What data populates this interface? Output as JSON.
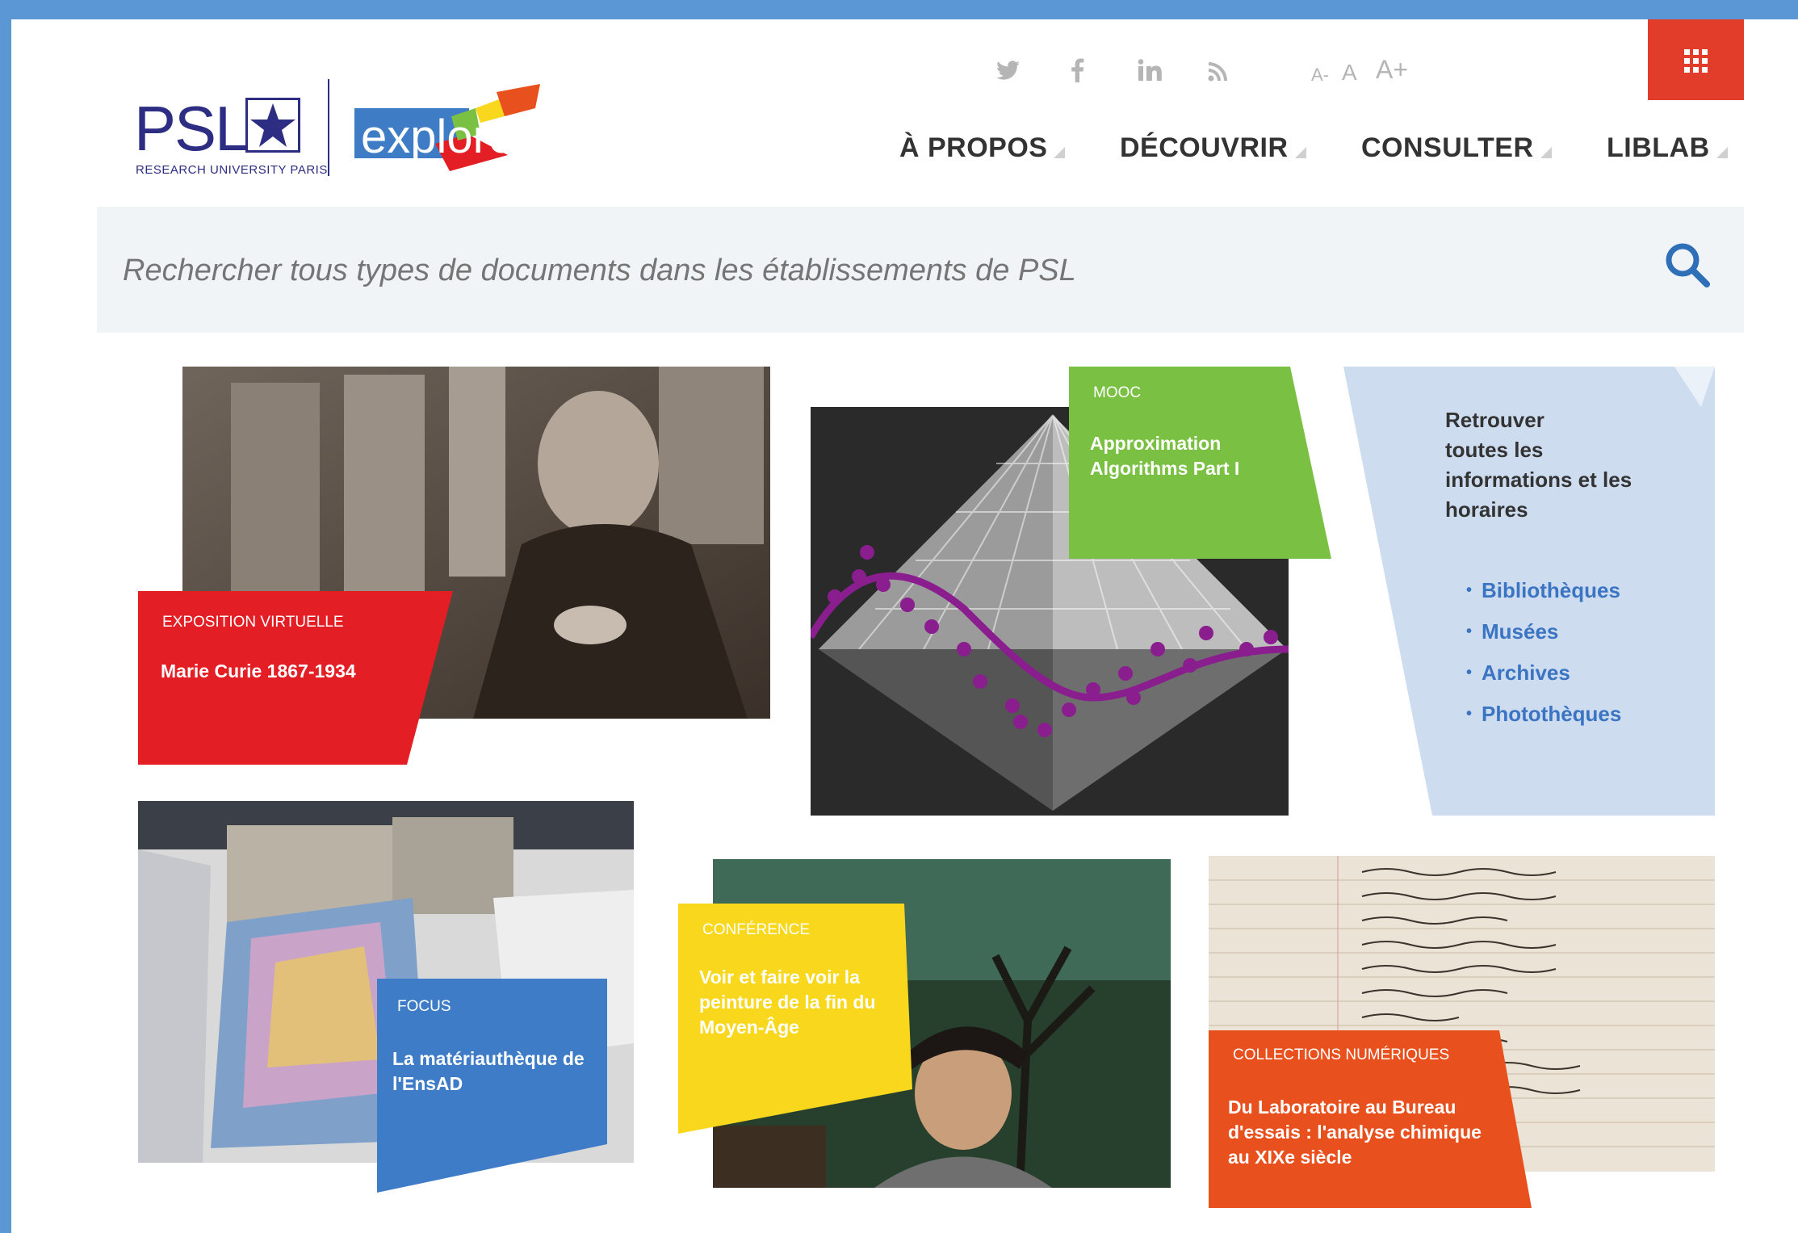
{
  "header": {
    "logo": {
      "psl": "PSL",
      "subtitle": "RESEARCH UNIVERSITY PARIS",
      "explore": "explore"
    },
    "social_icons": [
      "twitter-icon",
      "facebook-icon",
      "linkedin-icon",
      "rss-icon"
    ],
    "font_size": {
      "small": "A-",
      "normal": "A",
      "large": "A+"
    },
    "apps_icon": "grid-icon",
    "nav": [
      {
        "label": "À PROPOS"
      },
      {
        "label": "DÉCOUVRIR"
      },
      {
        "label": "CONSULTER"
      },
      {
        "label": "LIBLAB"
      }
    ]
  },
  "search": {
    "placeholder": "Rechercher tous types de documents dans les établissements de PSL"
  },
  "tiles": {
    "curie": {
      "category": "EXPOSITION VIRTUELLE",
      "title": "Marie Curie 1867-1934"
    },
    "mooc": {
      "category": "MOOC",
      "title": "Approximation Algorithms Part I"
    },
    "focus": {
      "category": "FOCUS",
      "title": "La matériauthèque de l'EnsAD"
    },
    "conference": {
      "category": "CONFÉRENCE",
      "title": "Voir et faire voir la peinture de la fin du Moyen-Âge"
    },
    "collections": {
      "category": "COLLECTIONS NUMÉRIQUES",
      "title": "Du Laboratoire au Bureau d'essais : l'analyse chimique au XIXe siècle"
    }
  },
  "info": {
    "text": "Retrouver toutes les informations et les horaires",
    "lines": [
      "Retrouver",
      "toutes les",
      "informations et les",
      "horaires"
    ],
    "links": [
      "Bibliothèques",
      "Musées",
      "Archives",
      "Photothèques"
    ]
  },
  "colors": {
    "red": "#e31e24",
    "green": "#7ac143",
    "blue": "#3f7cc7",
    "yellow": "#f8d71c",
    "orange": "#e8501e",
    "lightblue": "#cdddef"
  }
}
